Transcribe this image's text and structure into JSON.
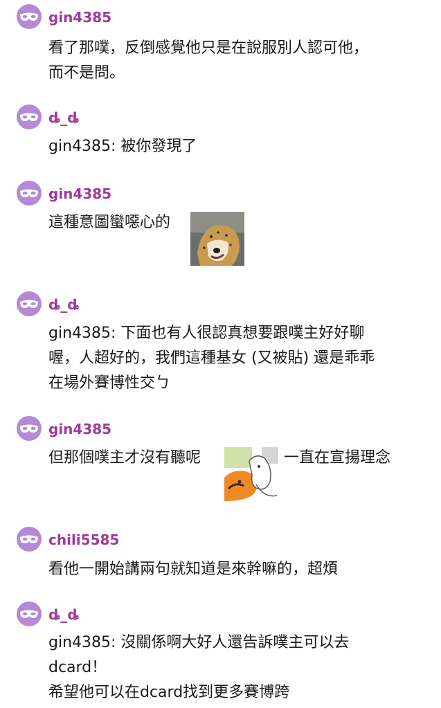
{
  "comments": [
    {
      "username": "gin4385",
      "lines": [
        "看了那噗，反倒感覺他只是在說服別人認可他，",
        "而不是問。"
      ]
    },
    {
      "username": "ȡ_ȡ",
      "lines": [
        "gin4385: 被你發現了"
      ]
    },
    {
      "username": "gin4385",
      "lines": [
        "這種意圖蠻噁心的"
      ],
      "sticker": "cheetah-sticker"
    },
    {
      "username": "ȡ_ȡ",
      "lines": [
        "gin4385: 下面也有人很認真想要跟噗主好好聊",
        "喔，人超好的，我們這種基女 (又被貼) 還是乖乖",
        "在場外賽博性交ㄅ"
      ]
    },
    {
      "username": "gin4385",
      "lines": [
        "但那個噗主才沒有聽呢"
      ],
      "tail": "一直在宣揚理念",
      "sticker": "cartoon-sticker"
    },
    {
      "username": "chili5585",
      "lines": [
        "看他一開始講兩句就知道是來幹嘛的，超煩"
      ]
    },
    {
      "username": "ȡ_ȡ",
      "lines": [
        "gin4385: 沒關係啊大好人還告訴噗主可以去",
        "dcard！",
        "希望他可以在dcard找到更多賽博跨"
      ]
    }
  ],
  "colors": {
    "avatar": "#b489d6",
    "username": "#a0389e",
    "text": "#1a1a1a"
  },
  "avatar_icon": "mask-icon"
}
